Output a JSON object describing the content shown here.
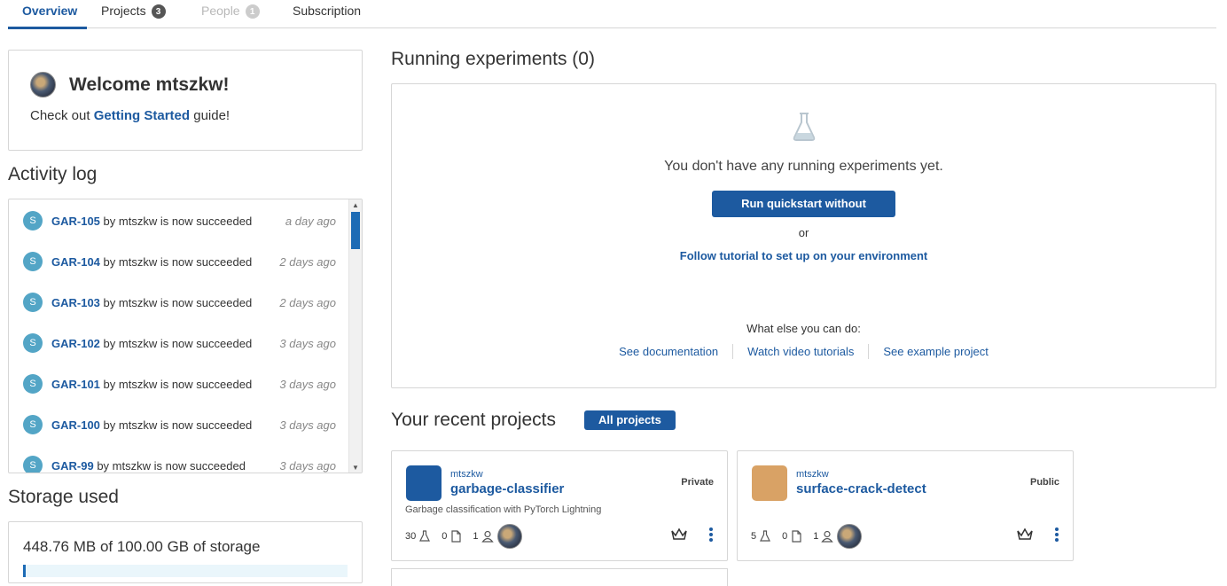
{
  "tabs": [
    {
      "label": "Overview"
    },
    {
      "label": "Projects",
      "badge": "3"
    },
    {
      "label": "People",
      "badge": "1"
    },
    {
      "label": "Subscription"
    }
  ],
  "welcome": {
    "title": "Welcome mtszkw!",
    "text_prefix": "Check out",
    "link": "Getting Started",
    "text_suffix": "guide!"
  },
  "activity": {
    "title": "Activity log",
    "items": [
      {
        "avatar": "S",
        "id": "GAR-105",
        "text": "by mtszkw is now succeeded",
        "time": "a day ago"
      },
      {
        "avatar": "S",
        "id": "GAR-104",
        "text": "by mtszkw is now succeeded",
        "time": "2 days ago"
      },
      {
        "avatar": "S",
        "id": "GAR-103",
        "text": "by mtszkw is now succeeded",
        "time": "2 days ago"
      },
      {
        "avatar": "S",
        "id": "GAR-102",
        "text": "by mtszkw is now succeeded",
        "time": "3 days ago"
      },
      {
        "avatar": "S",
        "id": "GAR-101",
        "text": "by mtszkw is now succeeded",
        "time": "3 days ago"
      },
      {
        "avatar": "S",
        "id": "GAR-100",
        "text": "by mtszkw is now succeeded",
        "time": "3 days ago"
      },
      {
        "avatar": "S",
        "id": "GAR-99",
        "text": "by mtszkw is now succeeded",
        "time": "3 days ago"
      }
    ]
  },
  "storage": {
    "title": "Storage used",
    "text": "448.76 MB of 100.00 GB of storage",
    "fraction": 0.0045
  },
  "experiments": {
    "title": "Running experiments (0)",
    "empty_text": "You don't have any running experiments yet.",
    "quickstart_button": "Run quickstart without setup",
    "or_text": "or",
    "tutorial_link": "Follow tutorial to set up on your environment",
    "else_text": "What else you can do:",
    "links": [
      "See documentation",
      "Watch video tutorials",
      "See example project"
    ]
  },
  "recent": {
    "title": "Your recent projects",
    "all_button": "All projects",
    "projects": [
      {
        "owner": "mtszkw",
        "name": "garbage-classifier",
        "visibility": "Private",
        "description": "Garbage classification with PyTorch Lightning",
        "experiments": "30",
        "notebooks": "0",
        "members": "1",
        "icon_color": "#1d5aa0"
      },
      {
        "owner": "mtszkw",
        "name": "surface-crack-detect",
        "visibility": "Public",
        "description": "",
        "experiments": "5",
        "notebooks": "0",
        "members": "1",
        "icon_color": "#d9a265"
      }
    ]
  },
  "colors": {
    "accent": "#1d5aa0",
    "activity_avatar": "#53a5c6"
  }
}
